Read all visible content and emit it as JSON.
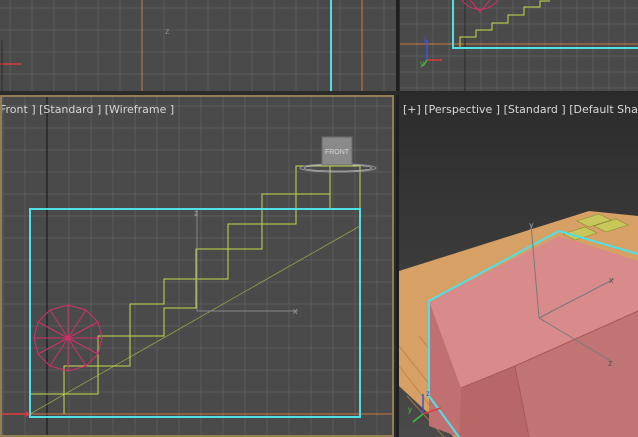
{
  "viewports": {
    "top_left": {
      "name": "top-left-viewport"
    },
    "top_right": {
      "name": "top-right-viewport"
    },
    "front": {
      "label": "Front ] [Standard ] [Wireframe ]",
      "viewcube_label": "FRONT"
    },
    "perspective": {
      "label": "[+] [Perspective ] [Standard ] [Default Shading"
    }
  },
  "axis_labels": {
    "x": "x",
    "y": "y",
    "z": "z"
  },
  "colors": {
    "grid": "#5a5a5a",
    "background": "#4a4a4a",
    "selection": "#4fe0e6",
    "stairs": "#c7d94a",
    "sphere": "#d0306a",
    "axis_x": "#d93c3c",
    "axis_y": "#3cc23c",
    "axis_z": "#3c54d9",
    "box_fill": "#d98a8a",
    "floor": "#d7a064",
    "active_frame": "#8f7f52"
  }
}
